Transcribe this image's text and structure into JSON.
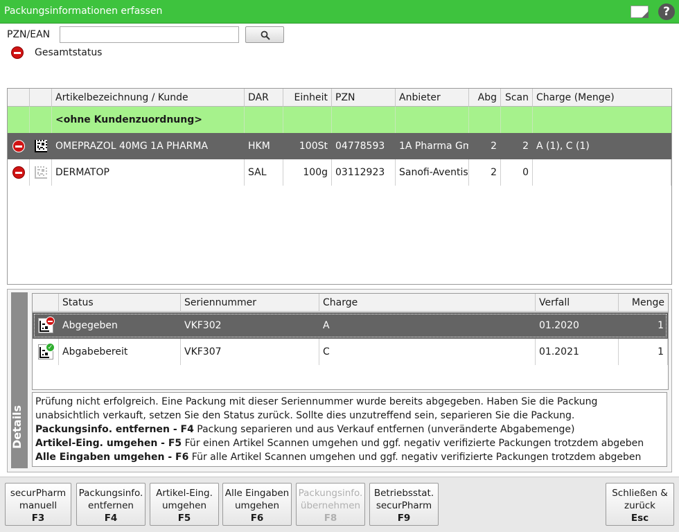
{
  "window": {
    "title": "Packungsinformationen erfassen"
  },
  "search": {
    "label": "PZN/EAN",
    "value": "",
    "placeholder": ""
  },
  "overall_status": {
    "label": "Gesamtstatus"
  },
  "articles": {
    "columns": [
      "",
      "",
      "Artikelbezeichnung / Kunde",
      "DAR",
      "Einheit",
      "PZN",
      "Anbieter",
      "Abg",
      "Scan",
      "Charge (Menge)"
    ],
    "group_label": "<ohne Kundenzuordnung>",
    "rows": [
      {
        "name": "OMEPRAZOL 40MG 1A PHARMA",
        "dar": "HKM",
        "einheit": "100St",
        "pzn": "04778593",
        "anbieter": "1A Pharma Gm",
        "abg": "2",
        "scan": "2",
        "charge": "A (1), C (1)"
      },
      {
        "name": "DERMATOP",
        "dar": "SAL",
        "einheit": "100g",
        "pzn": "03112923",
        "anbieter": "Sanofi-Aventis",
        "abg": "2",
        "scan": "0",
        "charge": ""
      }
    ]
  },
  "details": {
    "tab_label": "Details",
    "columns": [
      "",
      "Status",
      "Seriennummer",
      "Charge",
      "Verfall",
      "Menge"
    ],
    "rows": [
      {
        "status": "Abgegeben",
        "serial": "VKF302",
        "charge": "A",
        "verfall": "01.2020",
        "menge": "1"
      },
      {
        "status": "Abgabebereit",
        "serial": "VKF307",
        "charge": "C",
        "verfall": "01.2021",
        "menge": "1"
      }
    ],
    "message": {
      "intro": "Prüfung nicht erfolgreich. Eine Packung mit dieser Seriennummer wurde bereits abgegeben. Haben Sie die Packung unabsichtlich verkauft, setzen Sie den Status zurück. Sollte dies unzutreffend sein, separieren Sie die Packung.",
      "lines": [
        {
          "key": "Packungsinfo. entfernen - F4",
          "text": " Packung separieren und aus Verkauf entfernen (unveränderte Abgabemenge)"
        },
        {
          "key": "Artikel-Eing. umgehen - F5",
          "text": " Für einen Artikel Scannen umgehen und ggf. negativ verifizierte Packungen trotzdem abgeben"
        },
        {
          "key": "Alle Eingaben umgehen - F6",
          "text": " Für alle Artikel Scannen umgehen und ggf. negativ verifizierte Packungen trotzdem abgeben"
        }
      ]
    }
  },
  "footer": {
    "buttons": [
      {
        "l1": "securPharm",
        "l2": "manuell",
        "key": "F3"
      },
      {
        "l1": "Packungsinfo.",
        "l2": "entfernen",
        "key": "F4"
      },
      {
        "l1": "Artikel-Eing.",
        "l2": "umgehen",
        "key": "F5"
      },
      {
        "l1": "Alle Eingaben",
        "l2": "umgehen",
        "key": "F6"
      },
      {
        "l1": "Packungsinfo.",
        "l2": "übernehmen",
        "key": "F8"
      },
      {
        "l1": "Betriebsstat.",
        "l2": "securPharm",
        "key": "F9"
      },
      {
        "l1": "Schließen &",
        "l2": "zurück",
        "key": "Esc"
      }
    ]
  },
  "colors": {
    "title_green": "#3ec33e",
    "group_green": "#a6f28c",
    "selected_row": "#646464",
    "error_red": "#d01414",
    "ok_green": "#2fae2f"
  }
}
